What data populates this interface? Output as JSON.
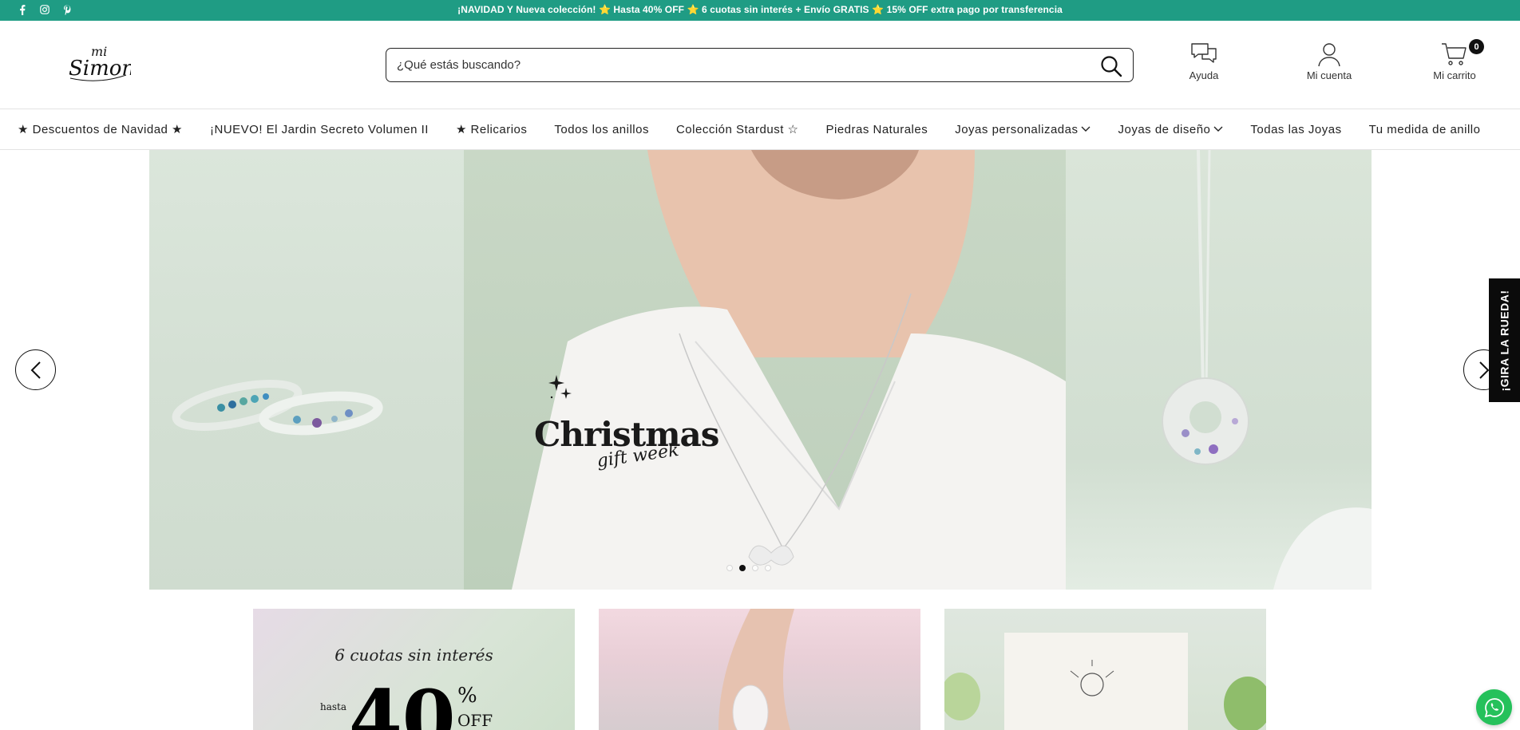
{
  "topbar": {
    "announcement": "¡NAVIDAD Y Nueva colección! ⭐ Hasta 40% OFF ⭐ 6 cuotas sin interés + Envío GRATIS ⭐ 15% OFF extra pago por transferencia",
    "social_icons": [
      "facebook-icon",
      "instagram-icon",
      "pinterest-icon"
    ],
    "background": "#1f9c84"
  },
  "header": {
    "logo_text": "Simona",
    "logo_small": "mi",
    "search_placeholder": "¿Qué estás buscando?",
    "help_label": "Ayuda",
    "account_label": "Mi cuenta",
    "cart_label": "Mi carrito",
    "cart_count": "0"
  },
  "nav": {
    "items": [
      {
        "label": "★ Descuentos de Navidad ★",
        "dropdown": false
      },
      {
        "label": "¡NUEVO! El Jardin Secreto Volumen II",
        "dropdown": false
      },
      {
        "label": "★ Relicarios",
        "dropdown": false
      },
      {
        "label": "Todos los anillos",
        "dropdown": false
      },
      {
        "label": "Colección Stardust ☆",
        "dropdown": false
      },
      {
        "label": "Piedras Naturales",
        "dropdown": false
      },
      {
        "label": "Joyas personalizadas",
        "dropdown": true
      },
      {
        "label": "Joyas de diseño",
        "dropdown": true
      },
      {
        "label": "Todas las Joyas",
        "dropdown": false
      },
      {
        "label": "Tu medida de anillo",
        "dropdown": false
      }
    ]
  },
  "hero": {
    "title": "Christmas",
    "subtitle": "gift week",
    "slides": 4,
    "active_slide": 2
  },
  "side_tab": {
    "label": "¡GIRA LA RUEDA!"
  },
  "promo_cards": {
    "card1": {
      "line1": "6 cuotas sin interés",
      "hasta": "hasta",
      "big": "40",
      "pct": "%",
      "off": "OFF"
    }
  }
}
